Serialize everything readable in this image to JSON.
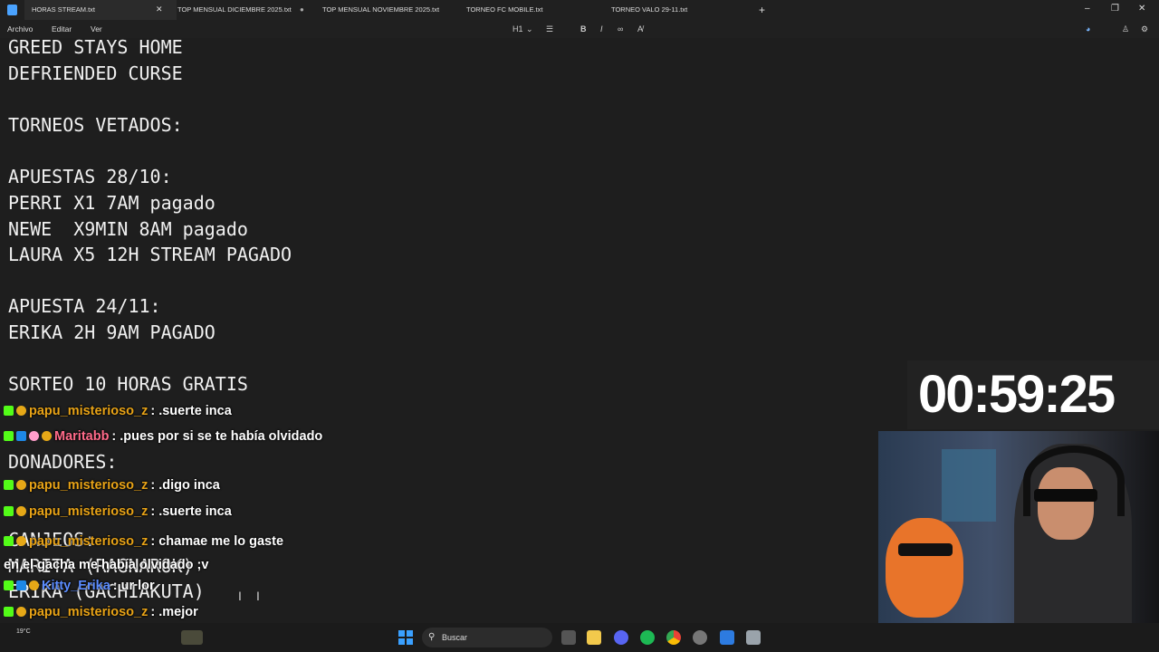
{
  "tabs": [
    {
      "label": "HORAS STREAM.txt",
      "active": true
    },
    {
      "label": "TOP MENSUAL DICIEMBRE 2025.txt",
      "active": false
    },
    {
      "label": "TOP MENSUAL NOVIEMBRE 2025.txt",
      "active": false
    },
    {
      "label": "TORNEO FC MOBILE.txt",
      "active": false
    },
    {
      "label": "TORNEO VALO 29-11.txt",
      "active": false
    }
  ],
  "window_controls": {
    "minimize": "–",
    "maximize": "❐",
    "close": "✕"
  },
  "menu": {
    "file": "Archivo",
    "edit": "Editar",
    "view": "Ver"
  },
  "format_toolbar": {
    "heading": "H1",
    "bold": "B",
    "italic": "I"
  },
  "editor_lines": [
    "GREED STAYS HOME",
    "DEFRIENDED CURSE",
    "",
    "TORNEOS VETADOS:",
    "",
    "APUESTAS 28/10:",
    "PERRI X1 7AM pagado",
    "NEWE  X9MIN 8AM pagado",
    "LAURA X5 12H STREAM PAGADO",
    "",
    "APUESTA 24/11:",
    "ERIKA 2H 9AM PAGADO",
    "",
    "SORTEO 10 HORAS GRATIS",
    "",
    "DONADORES:",
    "",
    "CANJEOS:",
    "MARITA (RAGNAROK)",
    "ERIKA (GACHIAKUTA)"
  ],
  "chat": [
    {
      "user": "papu_misterioso_z",
      "color": "#e8a317",
      "text": ".suerte inca"
    },
    {
      "user": "Maritabb",
      "color": "#ff6b8a",
      "text": ".pues por si se te había olvidado"
    },
    {
      "user": "papu_misterioso_z",
      "color": "#e8a317",
      "text": ".digo inca"
    },
    {
      "user": "papu_misterioso_z",
      "color": "#e8a317",
      "text": ".suerte inca"
    },
    {
      "user": "papu_misterioso_z",
      "color": "#e8a317",
      "text": "chamae me lo gaste en el gacha me había olvidado ;v"
    },
    {
      "user": "Kitty_Erika",
      "color": "#5b8cff",
      "text": "ur lor"
    },
    {
      "user": "papu_misterioso_z",
      "color": "#e8a317",
      "text": ".mejor"
    },
    {
      "user": "papu_misterioso_z",
      "color": "#e8a317",
      "text": ""
    }
  ],
  "timer": "00:59:25",
  "taskbar": {
    "search_placeholder": "Buscar",
    "weather_temp": "19°C"
  },
  "colors": {
    "kick_green": "#53fc18",
    "timer_bg": "#222222"
  }
}
